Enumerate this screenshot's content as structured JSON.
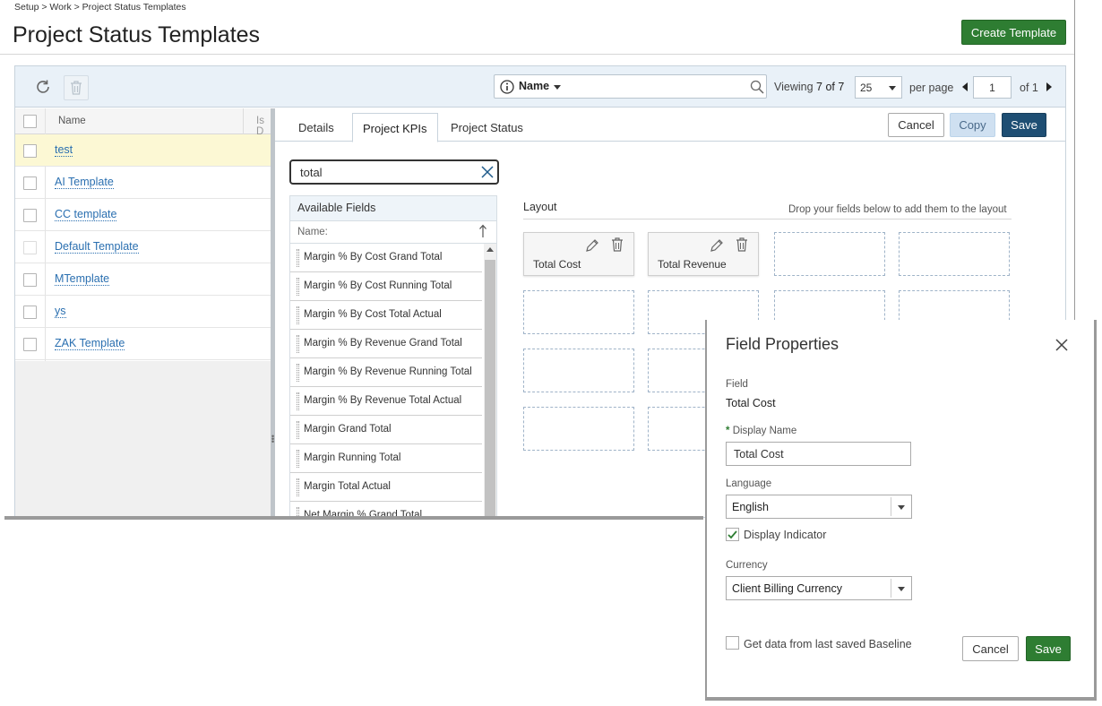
{
  "breadcrumb": "Setup > Work > Project Status Templates",
  "page_title": "Project Status Templates",
  "create_button": "Create Template",
  "toolbar": {
    "search_field": "Name",
    "viewing_label": "Viewing",
    "viewing_count": "7 of 7",
    "per_page_value": "25",
    "per_page_label": "per page",
    "page_value": "1",
    "of_label": "of 1"
  },
  "grid": {
    "columns": [
      "Name",
      "Is D"
    ],
    "rows": [
      {
        "name": "test",
        "selected": true
      },
      {
        "name": "AI Template"
      },
      {
        "name": "CC template"
      },
      {
        "name": "Default Template"
      },
      {
        "name": "MTemplate"
      },
      {
        "name": "ys"
      },
      {
        "name": "ZAK Template"
      }
    ]
  },
  "tabs": [
    "Details",
    "Project KPIs",
    "Project Status"
  ],
  "active_tab": "Project KPIs",
  "actions": {
    "cancel": "Cancel",
    "copy": "Copy",
    "save": "Save"
  },
  "kpi_search": "total",
  "available_fields": {
    "title": "Available Fields",
    "subheader": "Name:",
    "items": [
      "Margin % By Cost Grand Total",
      "Margin % By Cost Running Total",
      "Margin % By Cost Total Actual",
      "Margin % By Revenue Grand Total",
      "Margin % By Revenue Running Total",
      "Margin % By Revenue Total Actual",
      "Margin Grand Total",
      "Margin Running Total",
      "Margin Total Actual",
      "Net Margin % Grand Total"
    ]
  },
  "layout": {
    "title": "Layout",
    "hint": "Drop your fields below to add them to the layout",
    "cards": [
      "Total Cost",
      "Total Revenue"
    ]
  },
  "field_properties": {
    "title": "Field Properties",
    "field_label": "Field",
    "field_value": "Total Cost",
    "required_mark": "*",
    "display_name_label": "Display Name",
    "display_name_value": "Total Cost",
    "language_label": "Language",
    "language_value": "English",
    "display_indicator_label": "Display Indicator",
    "display_indicator_checked": true,
    "currency_label": "Currency",
    "currency_value": "Client Billing Currency",
    "baseline_label": "Get data from last saved Baseline",
    "baseline_checked": false,
    "cancel": "Cancel",
    "save": "Save"
  },
  "colors": {
    "primary_green": "#2e7d32",
    "save_navy": "#1e4e73",
    "link_blue": "#2a6fb0",
    "selected_row": "#fcf8d4",
    "toolbar_bg": "#e9f1f8"
  }
}
